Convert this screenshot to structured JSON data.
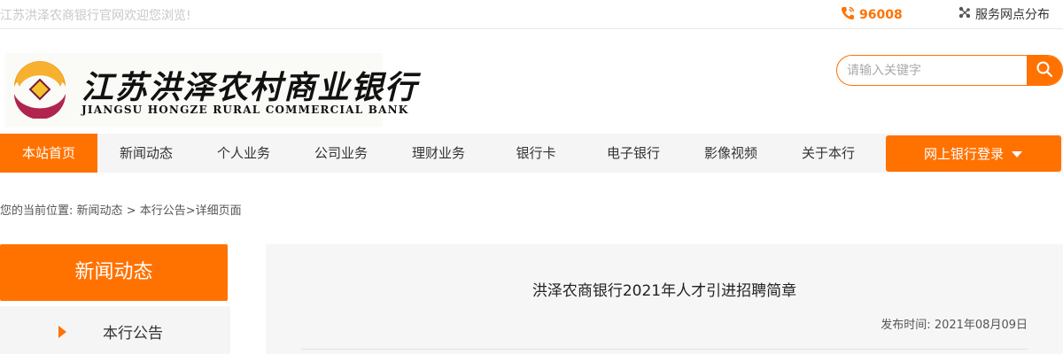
{
  "topbar": {
    "welcome": "江苏洪泽农商银行官网欢迎您浏览!",
    "hotline": "96008",
    "branches": "服务网点分布",
    "phone_icon": "phone-icon",
    "network_icon": "network-icon"
  },
  "logo": {
    "cn": "江苏洪泽农村商业银行",
    "en": "JIANGSU HONGZE RURAL COMMERCIAL BANK"
  },
  "search": {
    "placeholder": "请输入关键字",
    "value": ""
  },
  "nav": {
    "items": [
      {
        "label": "本站首页",
        "active": true
      },
      {
        "label": "新闻动态"
      },
      {
        "label": "个人业务"
      },
      {
        "label": "公司业务"
      },
      {
        "label": "理财业务"
      },
      {
        "label": "银行卡"
      },
      {
        "label": "电子银行"
      },
      {
        "label": "影像视频"
      },
      {
        "label": "关于本行"
      }
    ],
    "login": "网上银行登录"
  },
  "breadcrumb": {
    "prefix": "您的当前位置:",
    "news": "新闻动态",
    "sep1": ">",
    "notice": "本行公告",
    "sep2": ">",
    "current": "详细页面"
  },
  "sidebar": {
    "title": "新闻动态",
    "items": [
      {
        "label": "本行公告"
      }
    ]
  },
  "article": {
    "title": "洪泽农商银行2021年人才引进招聘简章",
    "date_label": "发布时间:",
    "date": "2021年08月09日"
  },
  "colors": {
    "accent": "#ff7200",
    "nav_bg": "#f5f5f5"
  }
}
